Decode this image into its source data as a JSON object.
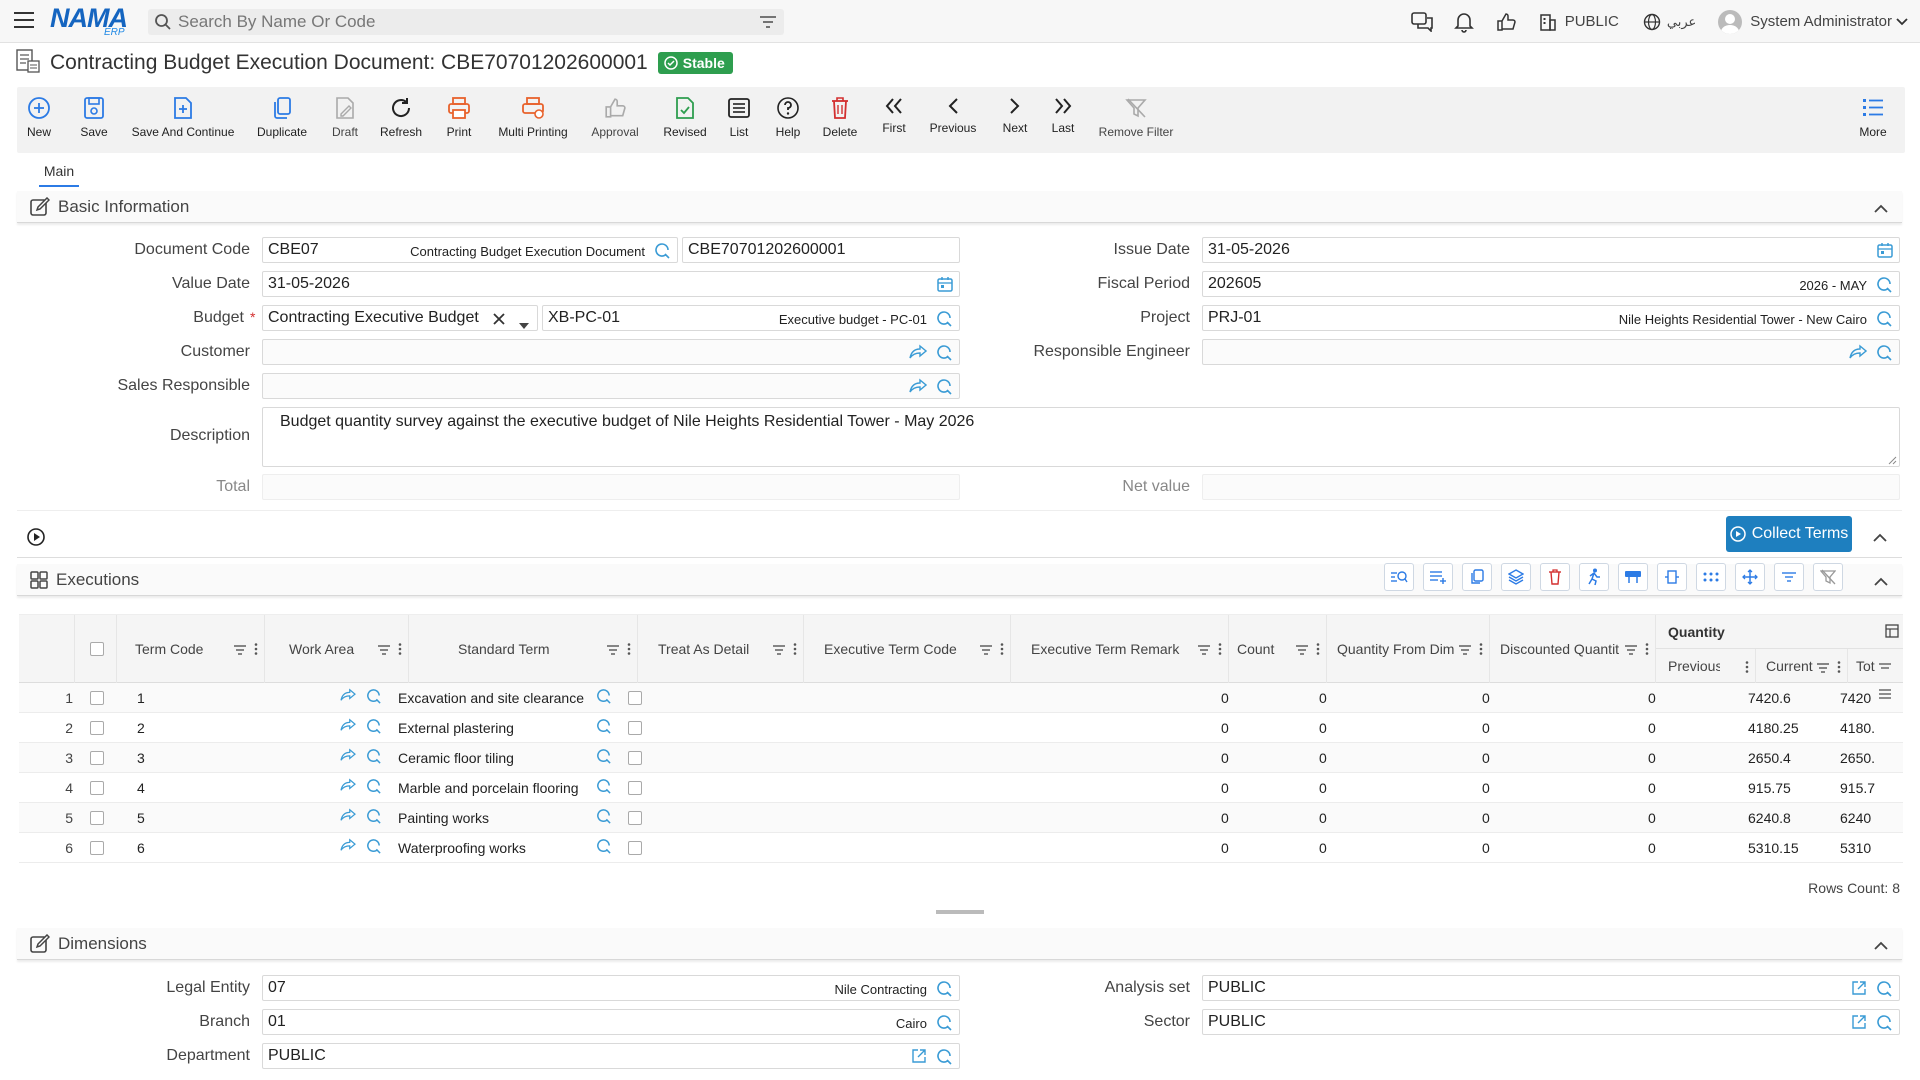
{
  "topbar": {
    "logo_text": "NAMA",
    "logo_sub": "ERP",
    "search_placeholder": "Search By Name Or Code",
    "company": "PUBLIC",
    "language": "عربي",
    "user": "System Administrator"
  },
  "title": {
    "text": "Contracting Budget Execution Document: CBE70701202600001",
    "status": "Stable"
  },
  "toolbar": {
    "new": "New",
    "save": "Save",
    "save_continue": "Save And Continue",
    "duplicate": "Duplicate",
    "draft": "Draft",
    "refresh": "Refresh",
    "print": "Print",
    "multi_printing": "Multi Printing",
    "approval": "Approval",
    "revised": "Revised",
    "list": "List",
    "help": "Help",
    "delete": "Delete",
    "first": "First",
    "previous": "Previous",
    "next": "Next",
    "last": "Last",
    "remove_filter": "Remove Filter",
    "more": "More"
  },
  "tabs": {
    "main": "Main"
  },
  "basic": {
    "title": "Basic Information",
    "document_code_label": "Document Code",
    "document_code": "CBE07",
    "document_code_hint": "Contracting Budget Execution Document",
    "document_number": "CBE70701202600001",
    "issue_date_label": "Issue Date",
    "issue_date": "31-05-2026",
    "value_date_label": "Value Date",
    "value_date": "31-05-2026",
    "fiscal_period_label": "Fiscal Period",
    "fiscal_period": "202605",
    "fiscal_period_hint": "2026 - MAY",
    "budget_label": "Budget",
    "budget_type": "Contracting Executive Budget",
    "budget_code": "XB-PC-01",
    "budget_hint": "Executive budget - PC-01",
    "project_label": "Project",
    "project_code": "PRJ-01",
    "project_hint": "Nile Heights Residential Tower - New Cairo",
    "customer_label": "Customer",
    "responsible_engineer_label": "Responsible Engineer",
    "sales_responsible_label": "Sales Responsible",
    "description_label": "Description",
    "description": "Budget quantity survey against the executive budget of Nile Heights Residential Tower - May 2026",
    "total_label": "Total",
    "net_value_label": "Net value"
  },
  "collect_terms": "Collect Terms",
  "executions": {
    "title": "Executions",
    "group_header": "Quantity",
    "columns": {
      "term_code": "Term Code",
      "work_area": "Work Area",
      "standard_term": "Standard Term",
      "treat_as_detail": "Treat As Detail",
      "executive_term_code": "Executive Term Code",
      "executive_term_remark": "Executive Term Remark",
      "count": "Count",
      "quantity_from_dim": "Quantity From Dim",
      "discounted_quantity": "Discounted Quantit",
      "previous": "Previous",
      "current": "Current",
      "total": "Tot"
    },
    "rows": [
      {
        "num": "1",
        "code": "1",
        "term": "Excavation and site clearance",
        "count": "0",
        "qfd": "0",
        "disc": "0",
        "prev": "0",
        "cur": "7420.6",
        "tot": "7420"
      },
      {
        "num": "2",
        "code": "2",
        "term": "External plastering",
        "count": "0",
        "qfd": "0",
        "disc": "0",
        "prev": "0",
        "cur": "4180.25",
        "tot": "4180."
      },
      {
        "num": "3",
        "code": "3",
        "term": "Ceramic floor tiling",
        "count": "0",
        "qfd": "0",
        "disc": "0",
        "prev": "0",
        "cur": "2650.4",
        "tot": "2650."
      },
      {
        "num": "4",
        "code": "4",
        "term": "Marble and porcelain flooring",
        "count": "0",
        "qfd": "0",
        "disc": "0",
        "prev": "0",
        "cur": "915.75",
        "tot": "915.7"
      },
      {
        "num": "5",
        "code": "5",
        "term": "Painting works",
        "count": "0",
        "qfd": "0",
        "disc": "0",
        "prev": "0",
        "cur": "6240.8",
        "tot": "6240"
      },
      {
        "num": "6",
        "code": "6",
        "term": "Waterproofing works",
        "count": "0",
        "qfd": "0",
        "disc": "0",
        "prev": "0",
        "cur": "5310.15",
        "tot": "5310"
      }
    ],
    "rows_count": "Rows Count: 8"
  },
  "dimensions": {
    "title": "Dimensions",
    "legal_entity_label": "Legal Entity",
    "legal_entity": "07",
    "legal_entity_hint": "Nile Contracting",
    "analysis_set_label": "Analysis set",
    "analysis_set": "PUBLIC",
    "branch_label": "Branch",
    "branch": "01",
    "branch_hint": "Cairo",
    "sector_label": "Sector",
    "sector": "PUBLIC",
    "department_label": "Department",
    "department": "PUBLIC"
  },
  "colors": {
    "accent": "#2c7be5",
    "stable": "#2e9e4f",
    "collect": "#1e7fbf",
    "delete": "#d32f2f",
    "print": "#e8622c"
  }
}
